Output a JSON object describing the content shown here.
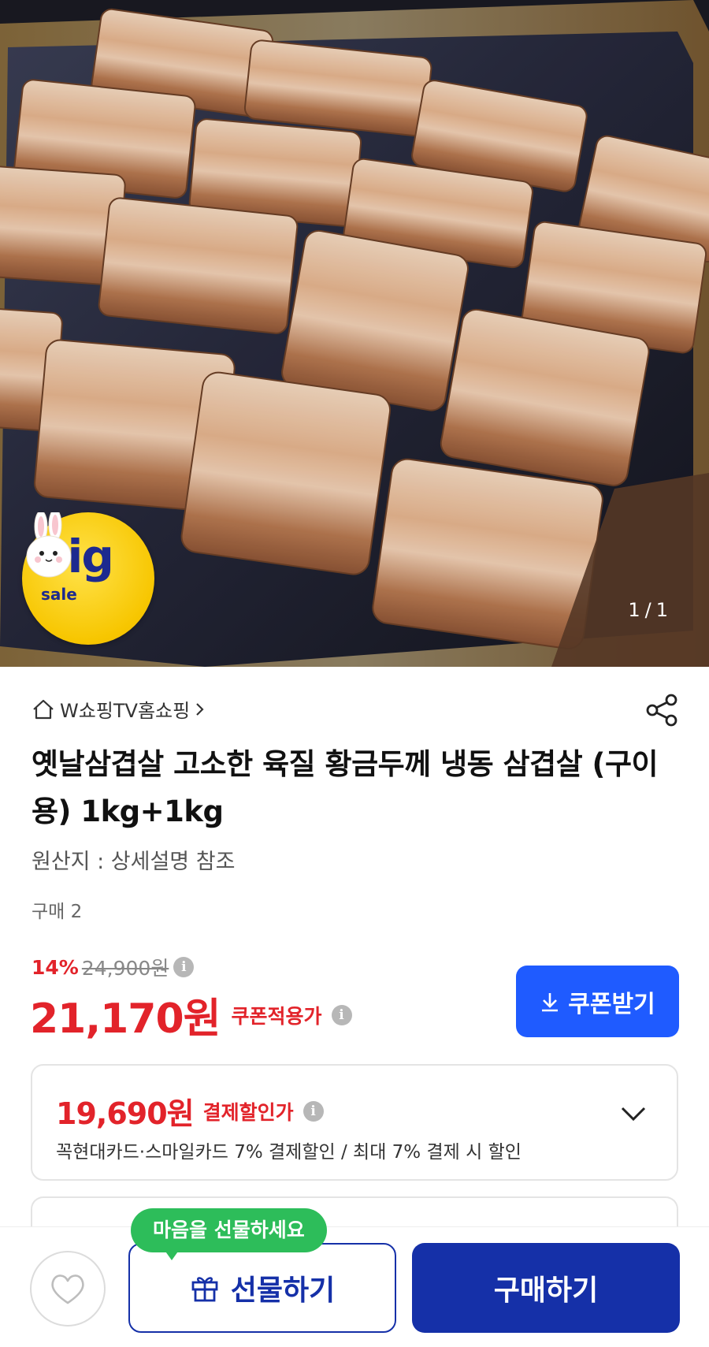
{
  "hero": {
    "counter_current": "1",
    "counter_separator": "/",
    "counter_total": "1",
    "badge_big": "big",
    "badge_sale": "sale"
  },
  "seller": {
    "name": "W쇼핑TV홈쇼핑",
    "home_icon": "home-icon",
    "arrow_icon": "chevron-right-icon",
    "share_icon": "share-icon"
  },
  "product": {
    "title": "옛날삼겹살 고소한 육질 황금두께 냉동 삼겹살 (구이용) 1kg+1kg",
    "origin": "원산지 : 상세설명 참조",
    "purchase_count": "구매 2"
  },
  "price": {
    "discount_rate": "14%",
    "original_price": "24,900원",
    "sale_price": "21,170원",
    "sale_label": "쿠폰적용가",
    "coupon_button": "쿠폰받기",
    "coupon_icon": "download-icon"
  },
  "card_discount": {
    "price": "19,690원",
    "label": "결제할인가",
    "description": "꼭현대카드·스마일카드 7% 결제할인 / 최대 7% 결제 시 할인"
  },
  "bottom_bar": {
    "tooltip": "마음을 선물하세요",
    "gift_button": "선물하기",
    "buy_button": "구매하기",
    "heart_icon": "heart-icon",
    "gift_icon": "gift-icon"
  },
  "colors": {
    "accent_red": "#e2232a",
    "coupon_blue": "#1f5bff",
    "buy_navy": "#1530a8",
    "tooltip_green": "#2dbd5a"
  }
}
